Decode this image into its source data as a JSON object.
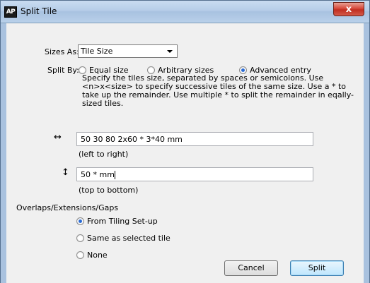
{
  "window": {
    "app_icon_text": "AP",
    "title": "Split Tile",
    "close_glyph": "x"
  },
  "sizes_as": {
    "label": "Sizes As:",
    "selected": "Tile Size"
  },
  "split_by": {
    "label": "Split By:",
    "options": [
      {
        "label": "Equal size",
        "selected": false
      },
      {
        "label": "Arbitrary sizes",
        "selected": false
      },
      {
        "label": "Advanced entry",
        "selected": true
      }
    ],
    "help": "Specify the tiles size, separated by spaces or semicolons. Use <n>x<size> to specify successive tiles of the same size. Use a * to take up the remainder. Use multiple * to split the remainder in eqally-sized tiles."
  },
  "horizontal": {
    "glyph": "↔",
    "value": "50 30 80 2x60 * 3*40 mm",
    "hint": "(left to right)"
  },
  "vertical": {
    "glyph": "↕",
    "value": "50 * mm",
    "hint": "(top to bottom)"
  },
  "overlaps": {
    "label": "Overlaps/Extensions/Gaps",
    "options": [
      {
        "label": "From Tiling Set-up",
        "selected": true
      },
      {
        "label": "Same as selected tile",
        "selected": false
      },
      {
        "label": "None",
        "selected": false
      }
    ]
  },
  "buttons": {
    "cancel": "Cancel",
    "split": "Split"
  }
}
